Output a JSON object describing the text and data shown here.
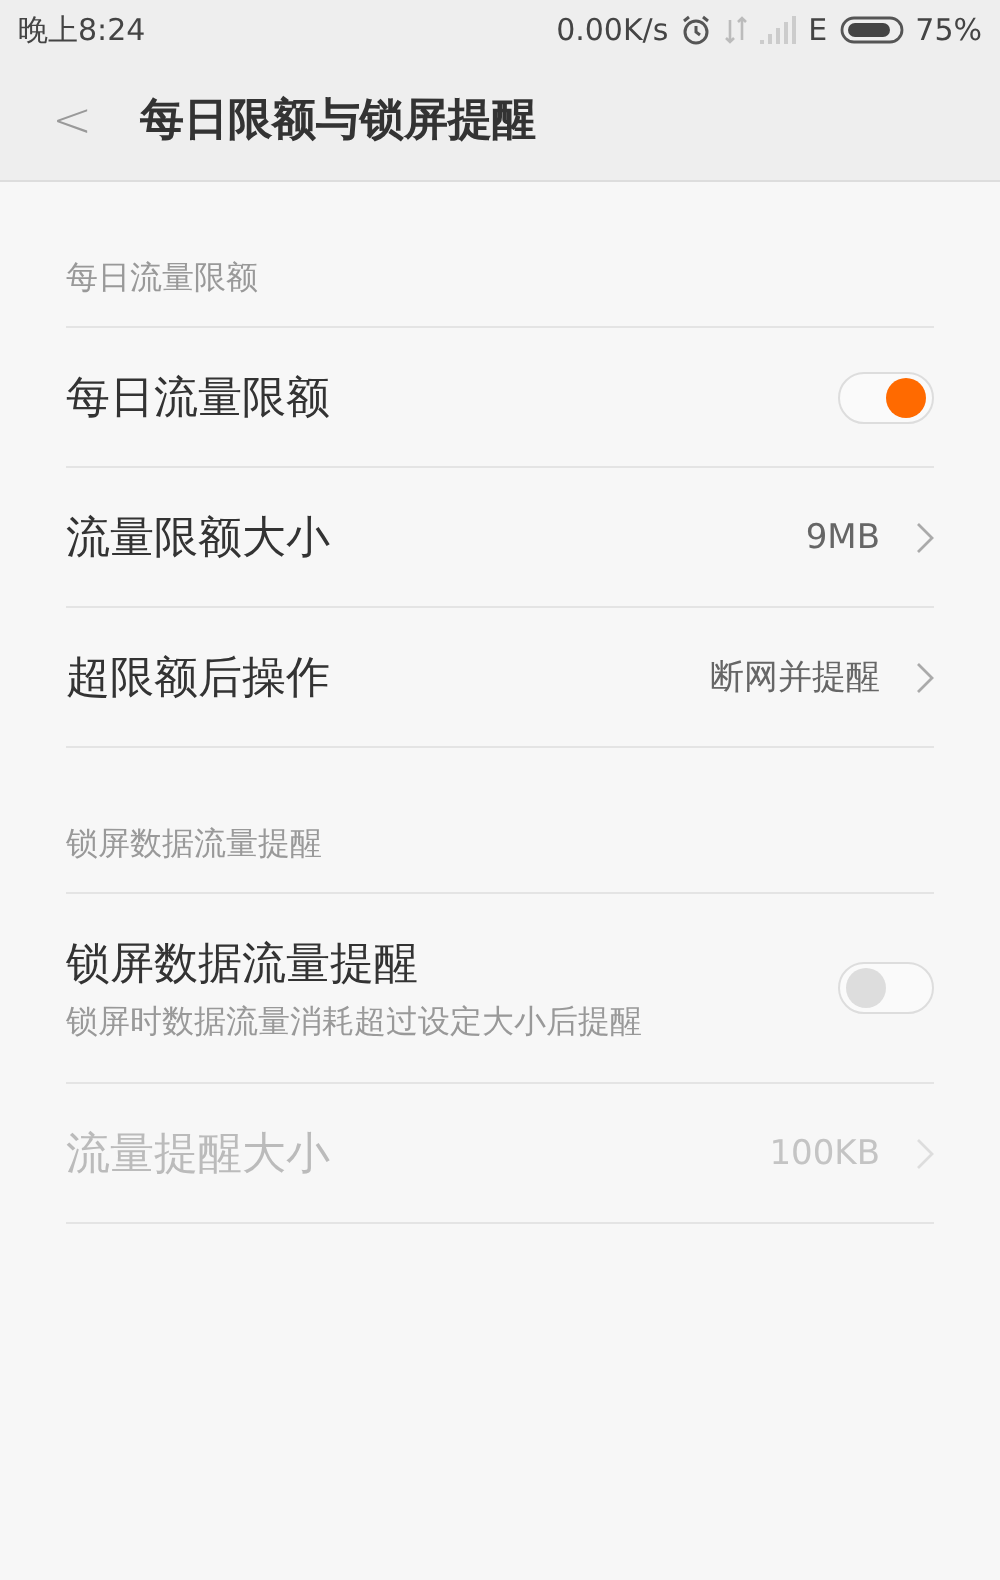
{
  "status_bar": {
    "time": "晚上8:24",
    "speed": "0.00K/s",
    "network": "E",
    "battery": "75%"
  },
  "header": {
    "back": "<",
    "title": "每日限额与锁屏提醒"
  },
  "sections": [
    {
      "title": "每日流量限额",
      "items": [
        {
          "kind": "toggle",
          "label": "每日流量限额",
          "on": true,
          "disabled": false
        },
        {
          "kind": "link",
          "label": "流量限额大小",
          "value": "9MB",
          "disabled": false
        },
        {
          "kind": "link",
          "label": "超限额后操作",
          "value": "断网并提醒",
          "disabled": false
        }
      ]
    },
    {
      "title": "锁屏数据流量提醒",
      "items": [
        {
          "kind": "toggle",
          "label": "锁屏数据流量提醒",
          "subtitle": "锁屏时数据流量消耗超过设定大小后提醒",
          "on": false,
          "disabled": false
        },
        {
          "kind": "link",
          "label": "流量提醒大小",
          "value": "100KB",
          "disabled": true
        }
      ]
    }
  ]
}
